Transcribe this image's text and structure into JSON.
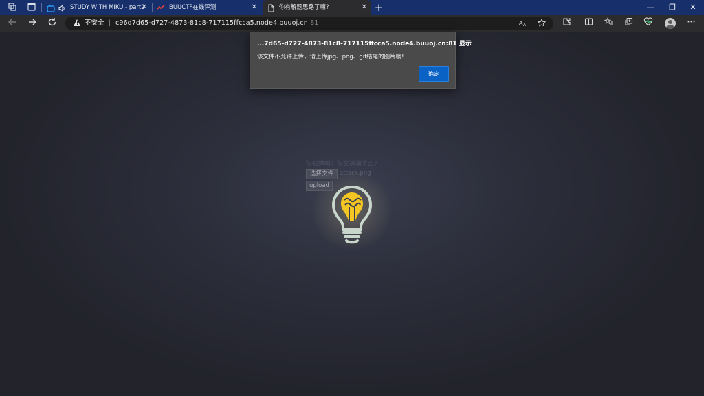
{
  "tabs": [
    {
      "title": "STUDY WITH MIKU - part2",
      "active": false,
      "close": "✕"
    },
    {
      "title": "BUUCTF在线评测",
      "active": false,
      "close": "✕"
    },
    {
      "title": "你有解题思路了嘛?",
      "active": true,
      "close": "✕"
    }
  ],
  "new_tab_label": "+",
  "window_controls": {
    "minimize": "—",
    "restore": "❐",
    "close": "✕"
  },
  "address_bar": {
    "security_label": "不安全",
    "separator": "|",
    "url_host": "c96d7d65-d727-4873-81c8-717115ffcca5.node4.buuoj.cn",
    "url_port": ":81"
  },
  "page": {
    "heading": "你知道吗？你又被骗了么?",
    "choose_file_label": "选择文件",
    "chosen_file_name": "attack.png",
    "upload_label": "upload"
  },
  "dialog": {
    "title": "...7d65-d727-4873-81c8-717115ffcca5.node4.buuoj.cn:81 显示",
    "message": "该文件不允许上传，请上传jpg、png、gif结尾的图片噢!",
    "ok_label": "确定"
  },
  "colors": {
    "tabstrip": "#17306c",
    "toolbar": "#2c2c2e",
    "dialog_bg": "#4a4a4a",
    "ok_button": "#0a63c4",
    "bulb_yellow": "#f3c623",
    "bulb_outline": "#c9d6cc"
  },
  "icons": [
    "workspaces-icon",
    "tab-actions-icon",
    "bilibili-icon",
    "audio-icon",
    "buuctf-icon",
    "page-icon",
    "back-icon",
    "forward-icon",
    "refresh-icon",
    "warning-icon",
    "read-aloud-icon",
    "favorite-star-icon",
    "extensions-icon",
    "split-screen-icon",
    "favorites-icon",
    "collections-icon",
    "heartbeat-icon",
    "profile-avatar",
    "more-icon",
    "lightbulb-icon"
  ]
}
